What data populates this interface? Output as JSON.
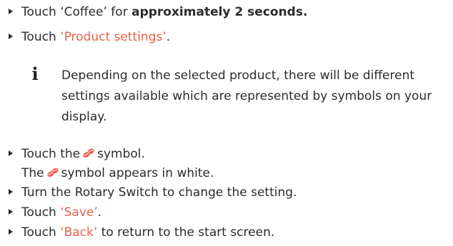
{
  "steps": [
    {
      "pre": "Touch ‘Coffee’ for ",
      "strong": "approximately 2 seconds."
    },
    {
      "pre": "Touch ",
      "highlight": "‘Product settings’",
      "post": "."
    },
    {
      "pre": "Touch the",
      "post": "symbol."
    },
    {
      "pre": "Turn the Rotary Switch to change the setting."
    },
    {
      "pre": "Touch ",
      "highlight": "‘Save’",
      "post": "."
    },
    {
      "pre": "Touch ",
      "highlight": "‘Back’",
      "post": " to return to the start screen."
    }
  ],
  "note": {
    "icon": "info-icon",
    "text": "Depending on the selected product, there will be different settings available which are represented by symbols on your display."
  },
  "continuation": {
    "pre": "The",
    "post": "symbol appears in white."
  },
  "symbol": {
    "icon": "coffee-strength-icon",
    "color": "#e8604c"
  }
}
